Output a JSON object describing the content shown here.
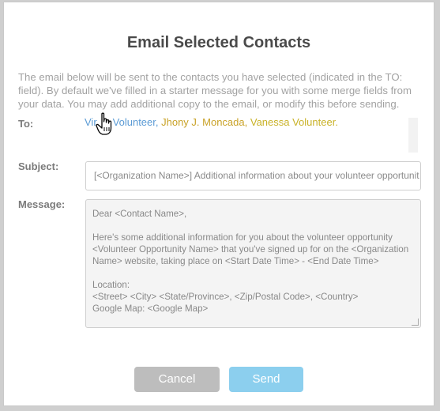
{
  "dialog": {
    "title": "Email Selected Contacts",
    "description": "The email below will be sent to the contacts you have selected (indicated in the TO: field). By default we've filled in a starter message for you with some merge fields from your data. You may add additional copy to the email, or modify this before sending."
  },
  "to": {
    "label": "To:",
    "recipients": [
      {
        "name": "Virginia Volunteer",
        "shown": "Vir",
        "rest": "Volunteer",
        "color": "#5b9bd5"
      },
      {
        "name": "Jhony J. Moncada",
        "color": "#c9a227"
      },
      {
        "name": "Vanessa Volunteer",
        "color": "#c9b227"
      }
    ]
  },
  "subject": {
    "label": "Subject:",
    "value": "[<Organization Name>] Additional information about your volunteer opportunit"
  },
  "message": {
    "label": "Message:",
    "lines": [
      "Dear <Contact Name>,",
      "",
      "Here's some additional information for you about the volunteer opportunity",
      "<Volunteer Opportunity Name> that you've signed up for on the <Organization",
      "Name> website, taking place on <Start Date Time> - <End Date Time>",
      "",
      "Location:",
      "<Street> <City> <State/Province>, <Zip/Postal Code>, <Country>",
      "Google Map: <Google Map>"
    ]
  },
  "buttons": {
    "cancel": "Cancel",
    "send": "Send"
  },
  "colors": {
    "send_button": "#8ccfee",
    "cancel_button": "#bdbdbd",
    "link_blue": "#5b9bd5",
    "link_gold": "#c9a227"
  },
  "icons": {
    "cursor": "hand-pointer-icon"
  }
}
